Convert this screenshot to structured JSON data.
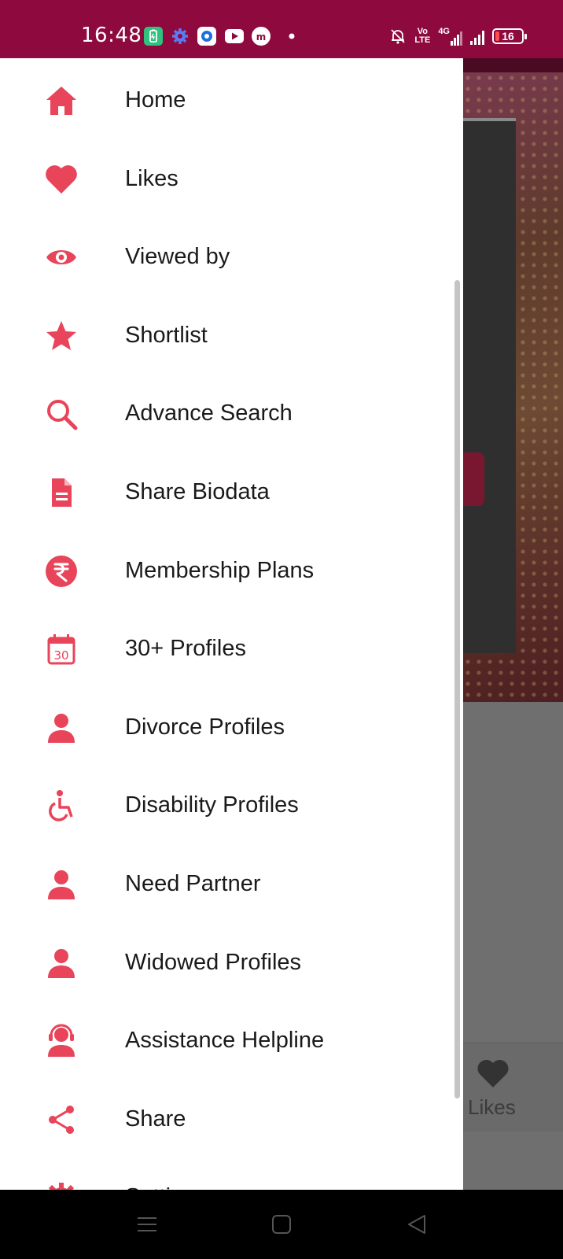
{
  "status_bar": {
    "time": "16:48",
    "left_icons": [
      "battery-saver-icon",
      "settings-gear-icon",
      "browser-icon",
      "youtube-icon",
      "app-icon",
      "dot-icon"
    ],
    "right_icons": [
      "mute-bell-icon",
      "volte-icon",
      "signal-4g-icon",
      "signal-icon"
    ],
    "volte_line1": "Vo",
    "volte_line2": "LTE",
    "network": "4G",
    "battery_level": "16"
  },
  "drawer": {
    "accent_color": "#e8445a",
    "items": [
      {
        "label": "Home",
        "icon": "home-icon"
      },
      {
        "label": "Likes",
        "icon": "heart-icon"
      },
      {
        "label": "Viewed by",
        "icon": "eye-icon"
      },
      {
        "label": "Shortlist",
        "icon": "star-icon"
      },
      {
        "label": "Advance Search",
        "icon": "search-icon"
      },
      {
        "label": "Share Biodata",
        "icon": "document-icon"
      },
      {
        "label": "Membership Plans",
        "icon": "rupee-icon"
      },
      {
        "label": "30+ Profiles",
        "icon": "calendar-30-icon"
      },
      {
        "label": "Divorce Profiles",
        "icon": "person-icon"
      },
      {
        "label": "Disability Profiles",
        "icon": "wheelchair-icon"
      },
      {
        "label": "Need Partner",
        "icon": "person-icon"
      },
      {
        "label": "Widowed Profiles",
        "icon": "person-icon"
      },
      {
        "label": "Assistance Helpline",
        "icon": "headset-person-icon"
      },
      {
        "label": "Share",
        "icon": "share-icon"
      },
      {
        "label": "Setti",
        "icon": "settings-icon"
      }
    ]
  },
  "background": {
    "bottom_tab_label": "Likes"
  },
  "nav_bar": {
    "buttons": [
      "menu-icon",
      "home-square-icon",
      "back-triangle-icon"
    ]
  }
}
